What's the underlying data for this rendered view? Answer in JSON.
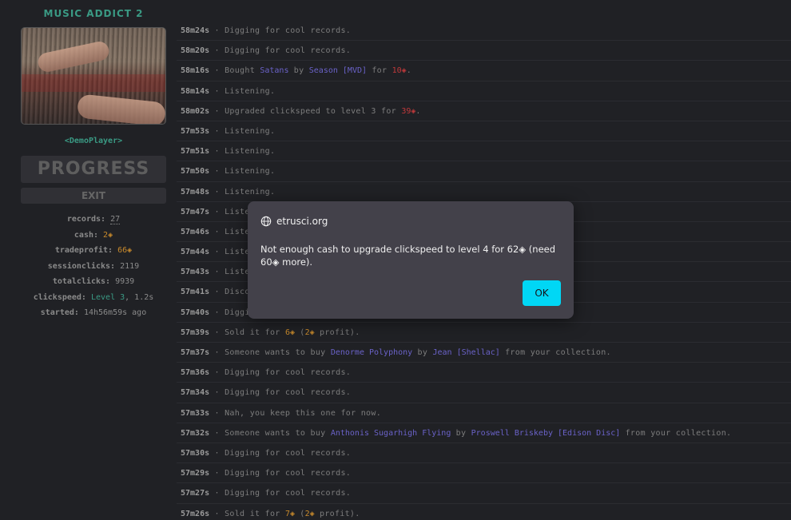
{
  "sidebar": {
    "title": "MUSIC ADDICT 2",
    "player": "<DemoPlayer>",
    "progress_label": "PROGRESS",
    "exit_label": "EXIT",
    "stats": {
      "records_k": "records:",
      "records_v": "27",
      "cash_k": "cash:",
      "cash_v": "2◈",
      "tradeprofit_k": "tradeprofit:",
      "tradeprofit_v": "66◈",
      "sessionclicks_k": "sessionclicks:",
      "sessionclicks_v": "2119",
      "totalclicks_k": "totalclicks:",
      "totalclicks_v": "9939",
      "clickspeed_k": "clickspeed:",
      "clickspeed_level": "Level 3",
      "clickspeed_rest": ", 1.2s",
      "started_k": "started:",
      "started_v": "14h56m59s ago"
    }
  },
  "log": [
    {
      "t": "58m24s",
      "parts": [
        {
          "c": "msg",
          "x": " · Digging for cool records."
        }
      ]
    },
    {
      "t": "58m20s",
      "parts": [
        {
          "c": "msg",
          "x": " · Digging for cool records."
        }
      ]
    },
    {
      "t": "58m16s",
      "parts": [
        {
          "c": "msg",
          "x": " · Bought "
        },
        {
          "c": "blue",
          "x": "Satans"
        },
        {
          "c": "msg",
          "x": " by "
        },
        {
          "c": "blue",
          "x": "Season [MVD]"
        },
        {
          "c": "msg",
          "x": " for "
        },
        {
          "c": "red",
          "x": "10◈"
        },
        {
          "c": "msg",
          "x": "."
        }
      ]
    },
    {
      "t": "58m14s",
      "parts": [
        {
          "c": "msg",
          "x": " · Listening."
        }
      ]
    },
    {
      "t": "58m02s",
      "parts": [
        {
          "c": "msg",
          "x": " · Upgraded clickspeed to level 3 for "
        },
        {
          "c": "red",
          "x": "39◈"
        },
        {
          "c": "msg",
          "x": "."
        }
      ]
    },
    {
      "t": "57m53s",
      "parts": [
        {
          "c": "msg",
          "x": " · Listening."
        }
      ]
    },
    {
      "t": "57m51s",
      "parts": [
        {
          "c": "msg",
          "x": " · Listening."
        }
      ]
    },
    {
      "t": "57m50s",
      "parts": [
        {
          "c": "msg",
          "x": " · Listening."
        }
      ]
    },
    {
      "t": "57m48s",
      "parts": [
        {
          "c": "msg",
          "x": " · Listening."
        }
      ]
    },
    {
      "t": "57m47s",
      "parts": [
        {
          "c": "msg",
          "x": " · Listening."
        }
      ]
    },
    {
      "t": "57m46s",
      "parts": [
        {
          "c": "msg",
          "x": " · Listening."
        }
      ]
    },
    {
      "t": "57m44s",
      "parts": [
        {
          "c": "msg",
          "x": " · Listening."
        }
      ]
    },
    {
      "t": "57m43s",
      "parts": [
        {
          "c": "msg",
          "x": " · Listening."
        }
      ]
    },
    {
      "t": "57m41s",
      "parts": [
        {
          "c": "msg",
          "x": " · Discovered a record."
        }
      ]
    },
    {
      "t": "57m40s",
      "parts": [
        {
          "c": "msg",
          "x": " · Digging for cool records."
        }
      ]
    },
    {
      "t": "57m39s",
      "parts": [
        {
          "c": "msg",
          "x": " · Sold it for "
        },
        {
          "c": "gold",
          "x": "6◈"
        },
        {
          "c": "msg",
          "x": " ("
        },
        {
          "c": "gold",
          "x": "2◈"
        },
        {
          "c": "msg",
          "x": " profit)."
        }
      ]
    },
    {
      "t": "57m37s",
      "parts": [
        {
          "c": "msg",
          "x": " · Someone wants to buy "
        },
        {
          "c": "blue",
          "x": "Denorme Polyphony"
        },
        {
          "c": "msg",
          "x": " by "
        },
        {
          "c": "blue",
          "x": "Jean [Shellac]"
        },
        {
          "c": "msg",
          "x": " from your collection."
        }
      ]
    },
    {
      "t": "57m36s",
      "parts": [
        {
          "c": "msg",
          "x": " · Digging for cool records."
        }
      ]
    },
    {
      "t": "57m34s",
      "parts": [
        {
          "c": "msg",
          "x": " · Digging for cool records."
        }
      ]
    },
    {
      "t": "57m33s",
      "parts": [
        {
          "c": "msg",
          "x": " · Nah, you keep this one for now."
        }
      ]
    },
    {
      "t": "57m32s",
      "parts": [
        {
          "c": "msg",
          "x": " · Someone wants to buy "
        },
        {
          "c": "blue",
          "x": "Anthonis Sugarhigh Flying"
        },
        {
          "c": "msg",
          "x": " by "
        },
        {
          "c": "blue",
          "x": "Proswell Briskeby [Edison Disc]"
        },
        {
          "c": "msg",
          "x": " from your collection."
        }
      ]
    },
    {
      "t": "57m30s",
      "parts": [
        {
          "c": "msg",
          "x": " · Digging for cool records."
        }
      ]
    },
    {
      "t": "57m29s",
      "parts": [
        {
          "c": "msg",
          "x": " · Digging for cool records."
        }
      ]
    },
    {
      "t": "57m27s",
      "parts": [
        {
          "c": "msg",
          "x": " · Digging for cool records."
        }
      ]
    },
    {
      "t": "57m26s",
      "parts": [
        {
          "c": "msg",
          "x": " · Sold it for "
        },
        {
          "c": "gold",
          "x": "7◈"
        },
        {
          "c": "msg",
          "x": " ("
        },
        {
          "c": "gold",
          "x": "2◈"
        },
        {
          "c": "msg",
          "x": " profit)."
        }
      ]
    }
  ],
  "dialog": {
    "origin": "etrusci.org",
    "message": "Not enough cash to upgrade clickspeed to level 4 for 62◈ (need 60◈ more).",
    "ok_label": "OK"
  }
}
